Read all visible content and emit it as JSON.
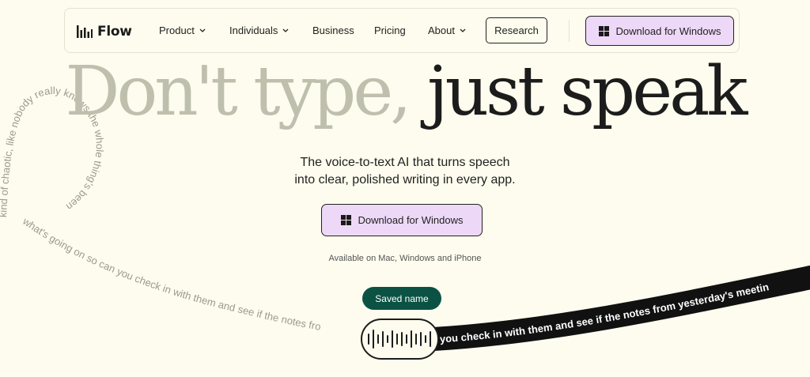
{
  "nav": {
    "logo_text": "Flow",
    "items": [
      {
        "label": "Product",
        "has_dropdown": true
      },
      {
        "label": "Individuals",
        "has_dropdown": true
      },
      {
        "label": "Business",
        "has_dropdown": false
      },
      {
        "label": "Pricing",
        "has_dropdown": false
      },
      {
        "label": "About",
        "has_dropdown": true
      }
    ],
    "research_label": "Research",
    "download_label": "Download for Windows"
  },
  "hero": {
    "light_text": "Don't type,",
    "dark_text": "just speak",
    "subtitle_line1": "The voice-to-text AI that turns speech",
    "subtitle_line2": "into clear, polished writing in every app.",
    "download_label": "Download for Windows",
    "availability": "Available on Mac, Windows and iPhone"
  },
  "demo": {
    "saved_label": "Saved name",
    "loop_text": "kind of chaotic, like nobody really knows the whole thing's been",
    "curve_text": "what's going on so can you check in with them and see if the notes fro",
    "ribbon_text": "you check in with them and see if the notes from yesterday's meetin"
  },
  "colors": {
    "background": "#fdfcee",
    "accent_lilac": "#eed8f7",
    "saved_green": "#0b5244",
    "hero_light": "#bfbfae",
    "ribbon": "#111111"
  },
  "icons": {
    "logo": "waveform-bars-icon",
    "windows": "windows-logo-icon",
    "chevron": "chevron-down-icon",
    "mic_wave": "voice-waveform-icon"
  }
}
